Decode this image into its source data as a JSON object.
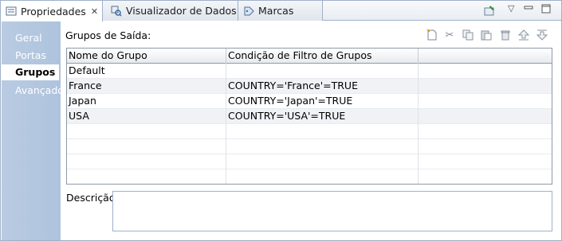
{
  "tabs": [
    {
      "label": "Propriedades",
      "icon": "properties-icon",
      "active": true,
      "closable": true
    },
    {
      "label": "Visualizador de Dados",
      "icon": "data-viewer-icon",
      "active": false
    },
    {
      "label": "Marcas",
      "icon": "bookmark-icon",
      "active": false
    }
  ],
  "view_actions": [
    "pin-icon",
    "view-menu-icon",
    "minimize-icon",
    "maximize-icon"
  ],
  "sidebar": {
    "items": [
      {
        "label": "Geral",
        "selected": false
      },
      {
        "label": "Portas",
        "selected": false
      },
      {
        "label": "Grupos",
        "selected": true
      },
      {
        "label": "Avançado",
        "selected": false
      }
    ]
  },
  "main": {
    "section_label": "Grupos de Saída:",
    "toolbar": [
      "new-icon",
      "cut-icon",
      "copy-icon",
      "paste-icon",
      "delete-icon",
      "move-up-icon",
      "move-down-icon"
    ],
    "table": {
      "columns": [
        "Nome do Grupo",
        "Condição de Filtro de Grupos",
        ""
      ],
      "rows": [
        [
          "Default",
          ""
        ],
        [
          "France",
          "COUNTRY='France'=TRUE"
        ],
        [
          "Japan",
          "COUNTRY='Japan'=TRUE"
        ],
        [
          "USA",
          "COUNTRY='USA'=TRUE"
        ],
        [
          "",
          ""
        ],
        [
          "",
          ""
        ],
        [
          "",
          ""
        ],
        [
          "",
          ""
        ]
      ]
    },
    "description_label": "Descrição:",
    "description_value": ""
  },
  "colors": {
    "sidebar_bg": "#aec3dd",
    "border": "#9fb1c9",
    "row_alt": "#f0f2f6"
  }
}
